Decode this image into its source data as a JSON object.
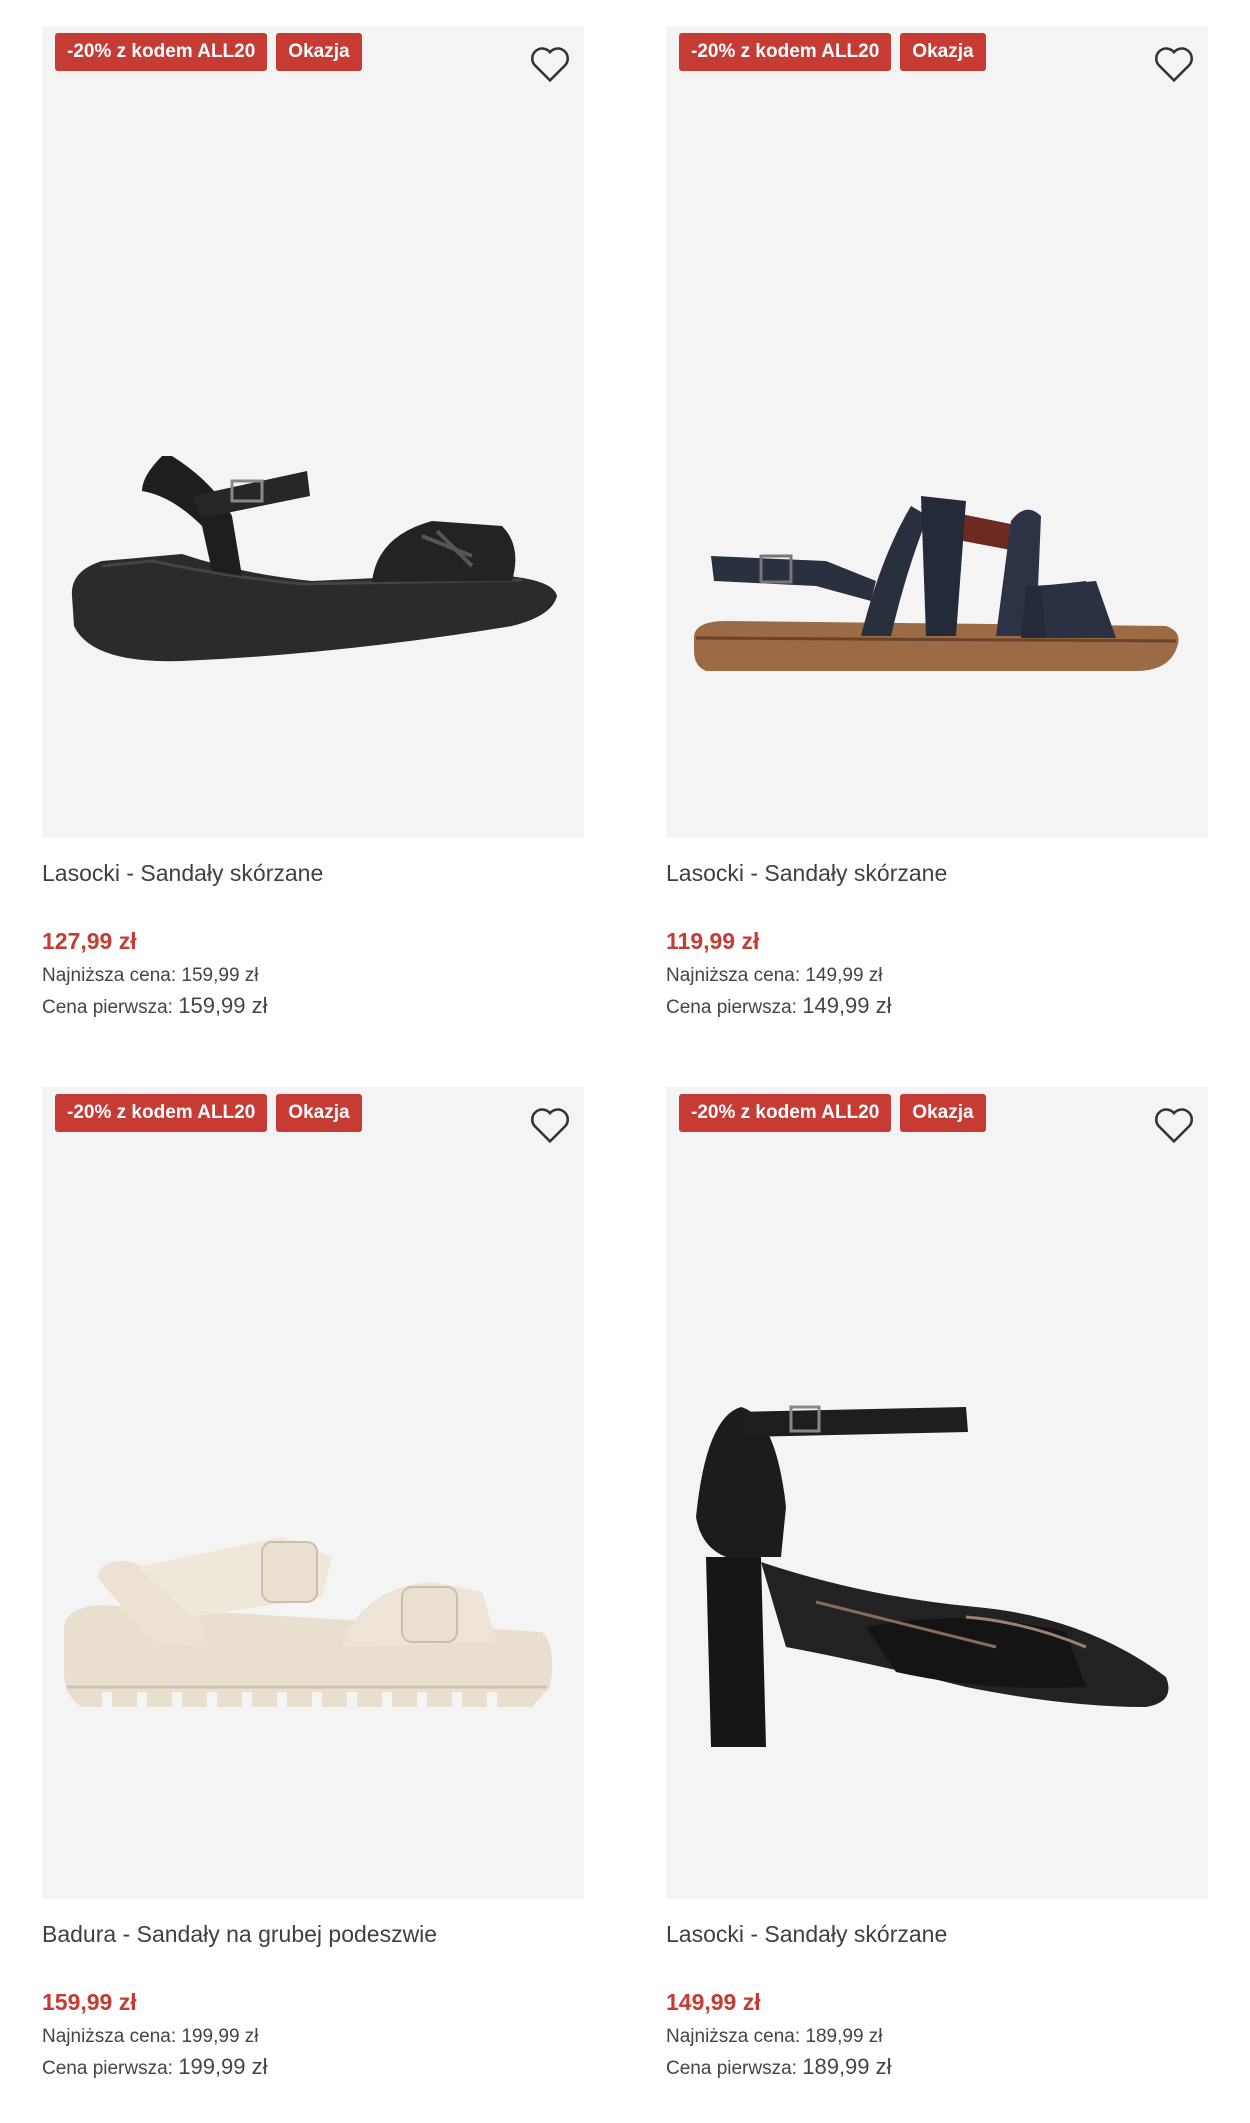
{
  "products": [
    {
      "badges": [
        "-20% z kodem ALL20",
        "Okazja"
      ],
      "name": "Lasocki - Sandały skórzane",
      "price": "127,99 zł",
      "lowest_label": "Najniższa cena:",
      "lowest_value": "159,99 zł",
      "first_label": "Cena pierwsza:",
      "first_value": "159,99 zł",
      "image_icon": "black-wedge-sandal-image"
    },
    {
      "badges": [
        "-20% z kodem ALL20",
        "Okazja"
      ],
      "name": "Lasocki - Sandały skórzane",
      "price": "119,99 zł",
      "lowest_label": "Najniższa cena:",
      "lowest_value": "149,99 zł",
      "first_label": "Cena pierwsza:",
      "first_value": "149,99 zł",
      "image_icon": "navy-flat-sandal-image"
    },
    {
      "badges": [
        "-20% z kodem ALL20",
        "Okazja"
      ],
      "name": "Badura - Sandały na grubej podeszwie",
      "price": "159,99 zł",
      "lowest_label": "Najniższa cena:",
      "lowest_value": "199,99 zł",
      "first_label": "Cena pierwsza:",
      "first_value": "199,99 zł",
      "image_icon": "cream-chunky-sandal-image"
    },
    {
      "badges": [
        "-20% z kodem ALL20",
        "Okazja"
      ],
      "name": "Lasocki - Sandały skórzane",
      "price": "149,99 zł",
      "lowest_label": "Najniższa cena:",
      "lowest_value": "189,99 zł",
      "first_label": "Cena pierwsza:",
      "first_value": "189,99 zł",
      "image_icon": "black-block-heel-sandal-image"
    }
  ],
  "colors": {
    "badge_bg": "#c63b34",
    "price": "#c63b34",
    "image_bg": "#f4f4f4"
  },
  "icons": {
    "favorite": "heart-outline-icon"
  }
}
